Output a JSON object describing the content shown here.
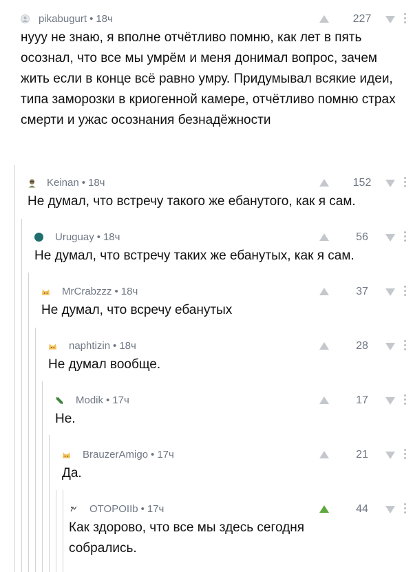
{
  "comments": [
    {
      "author": "pikabugurt",
      "time": "18ч",
      "score": "227",
      "text": "нууу не знаю, я вполне отчётливо помню, как лет в пять осознал, что все мы умрём и меня донимал вопрос, зачем жить если в конце всё равно умру. Придумывал всякие идеи, типа заморозки в криогенной камере, отчётливо помню страх смерти и ужас осознания безнадёжности",
      "avatar": "default-avatar-icon"
    },
    {
      "author": "Keinan",
      "time": "18ч",
      "score": "152",
      "text": "Не думал, что встречу такого же ебанутого, как я сам.",
      "avatar": "character-avatar-icon"
    },
    {
      "author": "Uruguay",
      "time": "18ч",
      "score": "56",
      "text": "Не думал, что встречу таких же ебанутых, как я сам.",
      "avatar": "globe-avatar-icon"
    },
    {
      "author": "MrCrabzzz",
      "time": "18ч",
      "score": "37",
      "text": "Не думал, что всречу ебанутых",
      "avatar": "cat-avatar-icon"
    },
    {
      "author": "naphtizin",
      "time": "18ч",
      "score": "28",
      "text": "Не думал вообще.",
      "avatar": "cat-avatar-icon"
    },
    {
      "author": "Modik",
      "time": "17ч",
      "score": "17",
      "text": "Не.",
      "avatar": "stripes-avatar-icon"
    },
    {
      "author": "BrauzerAmigo",
      "time": "17ч",
      "score": "21",
      "text": "Да.",
      "avatar": "cat-avatar-icon"
    },
    {
      "author": "OTOPOIIb",
      "time": "17ч",
      "score": "44",
      "text": "Как здорово, что все мы здесь сегодня собрались.",
      "avatar": "sketch-avatar-icon",
      "upvoted": true
    }
  ],
  "colors": {
    "upvote_active": "#5fa840",
    "vote_inactive": "#c4c8cc",
    "meta_text": "#6e7783",
    "thread_line": "#d2d2d2"
  }
}
